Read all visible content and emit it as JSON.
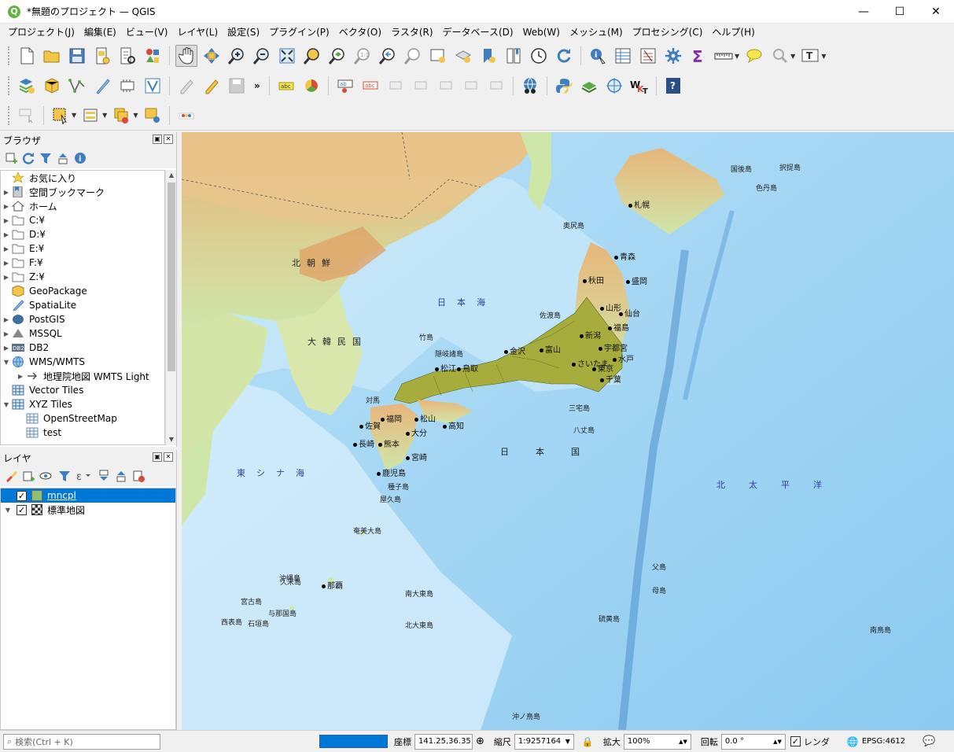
{
  "window": {
    "title": "*無題のプロジェクト — QGIS",
    "app_icon": "qgis-icon",
    "minimize": "—",
    "maximize": "☐",
    "close": "✕"
  },
  "menu": [
    "プロジェクト(J)",
    "編集(E)",
    "ビュー(V)",
    "レイヤ(L)",
    "設定(S)",
    "プラグイン(P)",
    "ベクタ(O)",
    "ラスタ(R)",
    "データベース(D)",
    "Web(W)",
    "メッシュ(M)",
    "プロセシング(C)",
    "ヘルプ(H)"
  ],
  "browser": {
    "title": "ブラウザ",
    "items": [
      {
        "label": "お気に入り",
        "icon": "star-icon",
        "arrow": "",
        "indent": 0
      },
      {
        "label": "空間ブックマーク",
        "icon": "bookmark-icon",
        "arrow": "▶",
        "indent": 0
      },
      {
        "label": "ホーム",
        "icon": "home-icon",
        "arrow": "▶",
        "indent": 0
      },
      {
        "label": "C:¥",
        "icon": "folder-icon",
        "arrow": "▶",
        "indent": 0
      },
      {
        "label": "D:¥",
        "icon": "folder-icon",
        "arrow": "▶",
        "indent": 0
      },
      {
        "label": "E:¥",
        "icon": "folder-icon",
        "arrow": "▶",
        "indent": 0
      },
      {
        "label": "F:¥",
        "icon": "folder-icon",
        "arrow": "▶",
        "indent": 0
      },
      {
        "label": "Z:¥",
        "icon": "folder-icon",
        "arrow": "▶",
        "indent": 0
      },
      {
        "label": "GeoPackage",
        "icon": "geopackage-icon",
        "arrow": "",
        "indent": 0
      },
      {
        "label": "SpatiaLite",
        "icon": "spatialite-icon",
        "arrow": "",
        "indent": 0
      },
      {
        "label": "PostGIS",
        "icon": "postgis-icon",
        "arrow": "▶",
        "indent": 0
      },
      {
        "label": "MSSQL",
        "icon": "mssql-icon",
        "arrow": "▶",
        "indent": 0
      },
      {
        "label": "DB2",
        "icon": "db2-icon",
        "arrow": "▶",
        "indent": 0
      },
      {
        "label": "WMS/WMTS",
        "icon": "globe-icon",
        "arrow": "▼",
        "indent": 0
      },
      {
        "label": "地理院地図 WMTS Light",
        "icon": "wms-layer-icon",
        "arrow": "▶",
        "indent": 1
      },
      {
        "label": "Vector Tiles",
        "icon": "grid-icon",
        "arrow": "",
        "indent": 0
      },
      {
        "label": "XYZ Tiles",
        "icon": "grid-icon",
        "arrow": "▼",
        "indent": 0
      },
      {
        "label": "OpenStreetMap",
        "icon": "tiles-icon",
        "arrow": "",
        "indent": 1
      },
      {
        "label": "test",
        "icon": "tiles-icon",
        "arrow": "",
        "indent": 1
      }
    ]
  },
  "layers": {
    "title": "レイヤ",
    "items": [
      {
        "label": "mncpl",
        "checked": "✓",
        "selected": true,
        "arrow": ""
      },
      {
        "label": "標準地図",
        "checked": "✓",
        "selected": false,
        "arrow": "▼"
      }
    ]
  },
  "map": {
    "regions": [
      "北朝鮮",
      "大韓民国",
      "日本海",
      "東シナ海",
      "日本国",
      "北太平洋"
    ],
    "cities": [
      "札幌",
      "青森",
      "秋田",
      "盛岡",
      "山形",
      "仙台",
      "福島",
      "新潟",
      "富山",
      "金沢",
      "宇都宮",
      "水戸",
      "さいたま",
      "東京",
      "千葉",
      "松江",
      "鳥取",
      "福岡",
      "松山",
      "高知",
      "佐賀",
      "長崎",
      "熊本",
      "大分",
      "宮崎",
      "鹿児島",
      "那覇"
    ],
    "islands": [
      "国後島",
      "択捉島",
      "色丹島",
      "奥尻島",
      "佐渡島",
      "隠岐諸島",
      "竹島",
      "対馬",
      "三宅島",
      "八丈島",
      "種子島",
      "屋久島",
      "奄美大島",
      "沖縄島",
      "石垣島",
      "西表島",
      "与那国島",
      "宮古島",
      "久米島",
      "南大東島",
      "北大東島",
      "父島",
      "母島",
      "硫黄島",
      "南鳥島",
      "沖ノ鳥島"
    ]
  },
  "status": {
    "search_placeholder": "検索(Ctrl + K)",
    "coord_label": "座標",
    "coord_value": "141.25,36.35",
    "scale_label": "縮尺",
    "scale_value": "1:9257164",
    "magnifier_label": "拡大",
    "magnifier_value": "100%",
    "rotation_label": "回転",
    "rotation_value": "0.0 °",
    "render_label": "レンダ",
    "crs": "EPSG:4612"
  },
  "colors": {
    "accent": "#0078d7",
    "sea": "#a9d8f5",
    "land_low": "#c9e3a6",
    "land_high": "#e8b57a",
    "municipalities": "#a6ad3d"
  }
}
